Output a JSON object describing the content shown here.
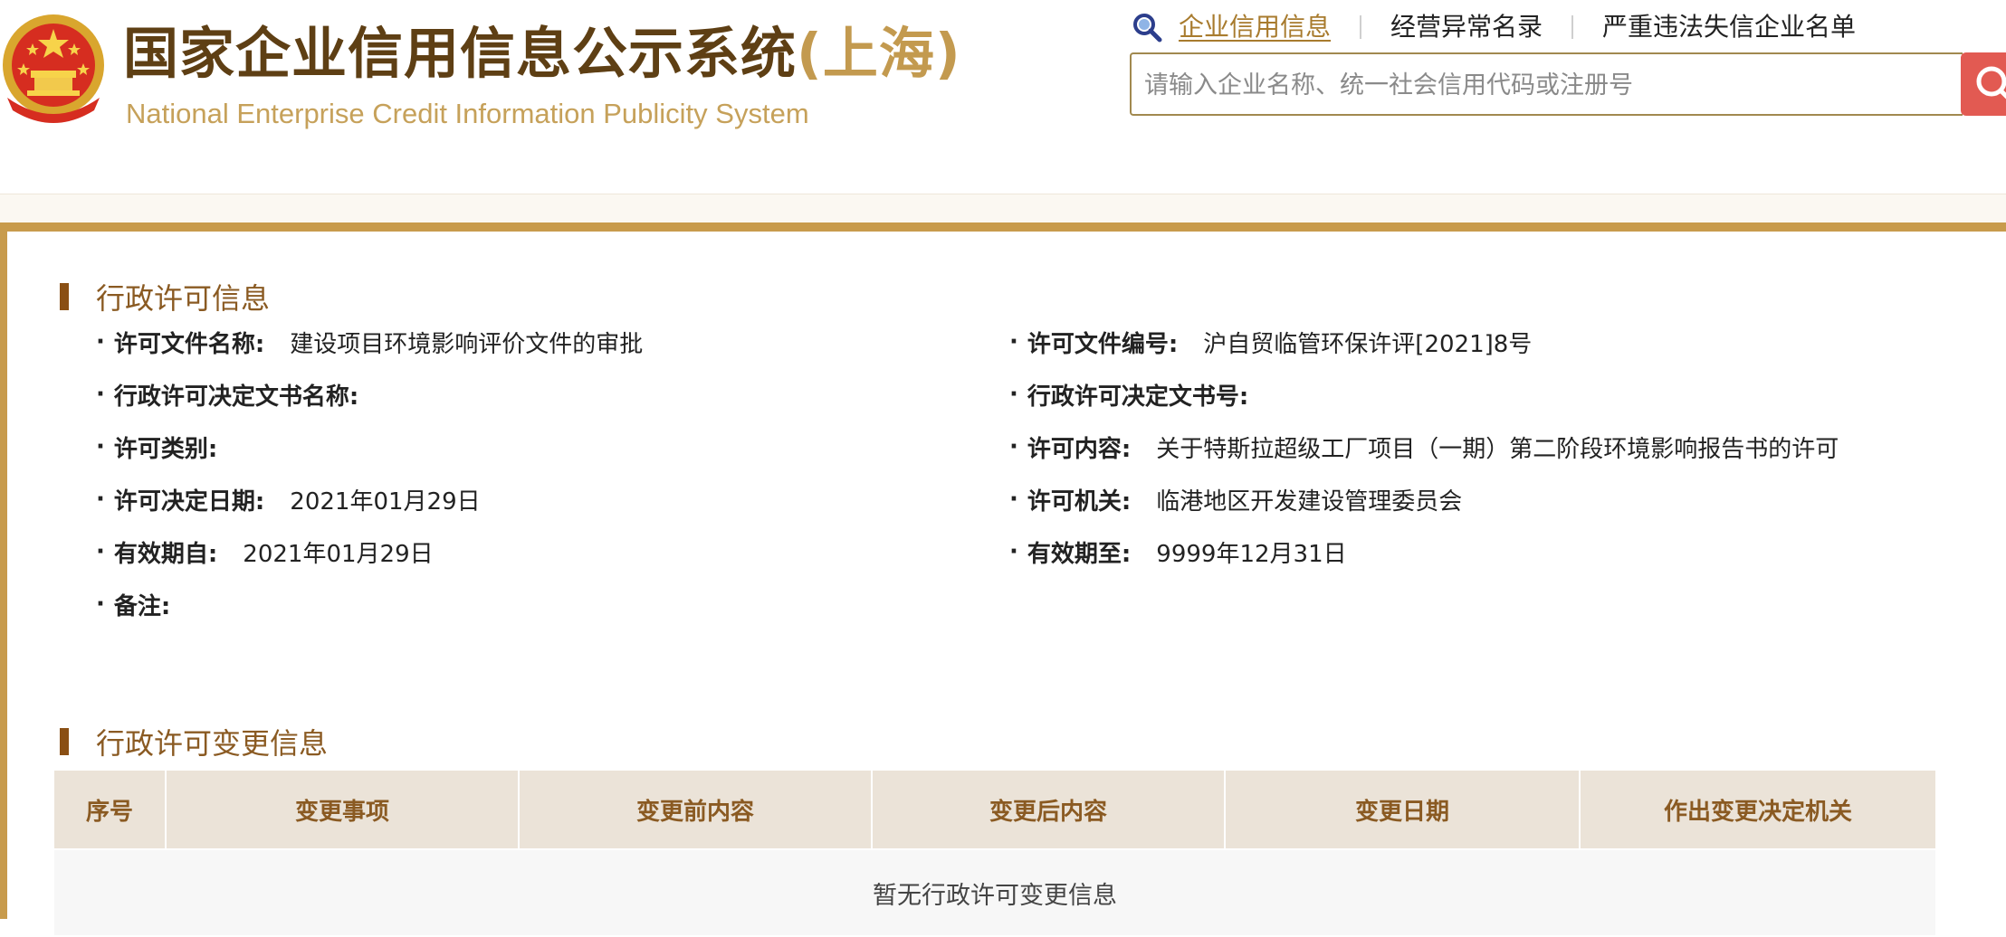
{
  "header": {
    "title": "国家企业信用信息公示系统",
    "region": "(上海)",
    "subtitle": "National Enterprise Credit Information Publicity System",
    "nav": [
      {
        "label": "企业信用信息",
        "active": true
      },
      {
        "label": "经营异常名录",
        "active": false
      },
      {
        "label": "严重违法失信企业名单",
        "active": false
      }
    ],
    "search": {
      "placeholder": "请输入企业名称、统一社会信用代码或注册号",
      "value": ""
    }
  },
  "license_section": {
    "heading": "行政许可信息",
    "left": [
      {
        "label": "许可文件名称:",
        "value": "建设项目环境影响评价文件的审批"
      },
      {
        "label": "行政许可决定文书名称:",
        "value": ""
      },
      {
        "label": "许可类别:",
        "value": ""
      },
      {
        "label": "许可决定日期:",
        "value": "2021年01月29日"
      },
      {
        "label": "有效期自:",
        "value": "2021年01月29日"
      },
      {
        "label": "备注:",
        "value": ""
      }
    ],
    "right": [
      {
        "label": "许可文件编号:",
        "value": "沪自贸临管环保许评[2021]8号"
      },
      {
        "label": "行政许可决定文书号:",
        "value": ""
      },
      {
        "label": "许可内容:",
        "value": "关于特斯拉超级工厂项目（一期）第二阶段环境影响报告书的许可"
      },
      {
        "label": "许可机关:",
        "value": "临港地区开发建设管理委员会"
      },
      {
        "label": "有效期至:",
        "value": "9999年12月31日"
      }
    ]
  },
  "change_section": {
    "heading": "行政许可变更信息",
    "columns": [
      "序号",
      "变更事项",
      "变更前内容",
      "变更后内容",
      "变更日期",
      "作出变更决定机关"
    ],
    "empty_text": "暂无行政许可变更信息"
  },
  "colors": {
    "brand_brown": "#5e3f14",
    "accent_gold": "#c89b4c",
    "heading_brown": "#8a5a22",
    "search_red": "#e25a52",
    "table_header_bg": "#ebe3d8"
  },
  "icons": {
    "emblem": "national-emblem-icon",
    "nav": "magnifier-icon",
    "search": "search-icon"
  }
}
